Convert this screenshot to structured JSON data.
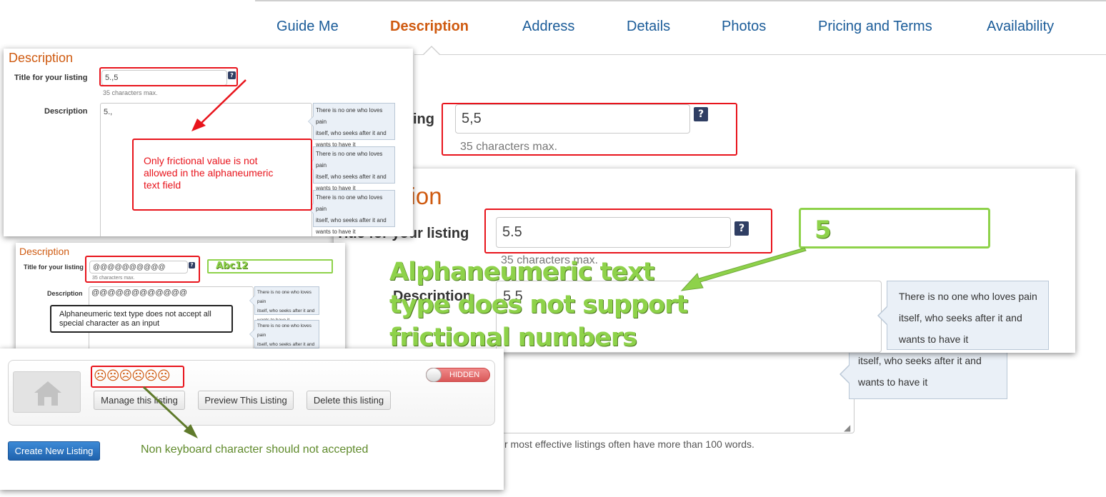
{
  "nav": {
    "tabs": [
      "Guide Me",
      "Description",
      "Address",
      "Details",
      "Photos",
      "Pricing and Terms",
      "Availability"
    ],
    "active": "Description"
  },
  "bg_form": {
    "label_partial": "ing",
    "title_value": "5,5",
    "chars_hint": "35 characters max.",
    "tip_line1": "itself, who seeks after it and",
    "tip_line2": "wants to have it",
    "words_hint": "r most effective listings often have more than 100 words."
  },
  "right_panel": {
    "heading_partial": "ption",
    "title_label": "Title for your listing",
    "title_value": "5.5",
    "chars_hint": "35 characters max.",
    "desc_label": "Description",
    "desc_value": "5.5",
    "tip_lines": [
      "There is no one who loves pain",
      "itself, who seeks after it and",
      "wants to have it"
    ],
    "green_value": "5",
    "green_note_lines": [
      "Alphaneumeric text",
      "type does not support",
      "frictional numbers"
    ]
  },
  "panel1": {
    "heading": "Description",
    "title_label": "Title for your listing",
    "title_value": "5.,5",
    "chars_hint": "35 characters max.",
    "desc_label": "Description",
    "desc_value": "5.,",
    "tip_lines": [
      "There is no one who loves pain",
      "itself, who seeks after it and",
      "wants to have it"
    ],
    "annotation_lines": [
      "Only frictional value is not",
      "allowed in the alphaneumeric",
      "text field"
    ]
  },
  "panel2": {
    "heading": "Description",
    "title_label": "Title for your listing",
    "title_value": "@@@@@@@@@@",
    "chars_hint": "35 characters max.",
    "desc_label": "Description",
    "desc_value": "@@@@@@@@@@@@",
    "green_value": "Abc12",
    "tip_lines": [
      "There is no one who loves pain",
      "itself, who seeks after it and",
      "wants to have it"
    ],
    "annotation_lines": [
      "Alphaneumeric text type does not accept all",
      "special character as an input"
    ]
  },
  "panel3": {
    "emoji_title": "☹☹☹☹☹☹",
    "toggle_label": "HIDDEN",
    "buttons": [
      "Manage this listing",
      "Preview This Listing",
      "Delete this listing"
    ],
    "create_button": "Create New Listing",
    "annotation": "Non keyboard character should not accepted"
  },
  "colors": {
    "accent_orange": "#cf5a10",
    "nav_blue": "#1b5c99",
    "annotation_red": "#e8141c",
    "annotation_green": "#8ed24a",
    "primary_blue": "#2a7ac8"
  }
}
